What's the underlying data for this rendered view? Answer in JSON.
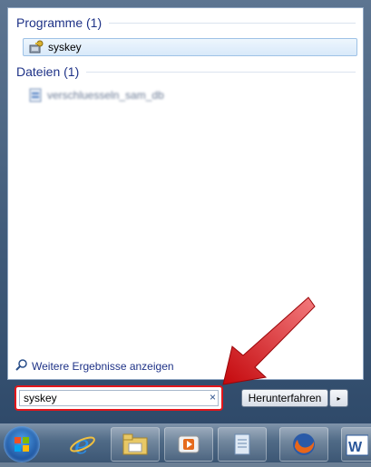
{
  "groups": [
    {
      "header": "Programme (1)",
      "items": [
        {
          "label": "syskey",
          "icon": "syskey-icon",
          "selected": true
        }
      ]
    },
    {
      "header": "Dateien (1)",
      "items": [
        {
          "label": "verschluesseln_sam_db",
          "icon": "document-icon",
          "blurred": true
        }
      ]
    }
  ],
  "more_results_label": "Weitere Ergebnisse anzeigen",
  "search": {
    "value": "syskey",
    "clear_glyph": "×"
  },
  "shutdown": {
    "label": "Herunterfahren",
    "arrow_glyph": "▸"
  },
  "taskbar": {
    "items": [
      "start-orb",
      "internet-explorer-icon",
      "file-explorer-icon",
      "media-player-icon",
      "notepad-icon",
      "firefox-icon",
      "word-icon"
    ]
  },
  "annotation": {
    "arrow_color": "#e3161b"
  }
}
